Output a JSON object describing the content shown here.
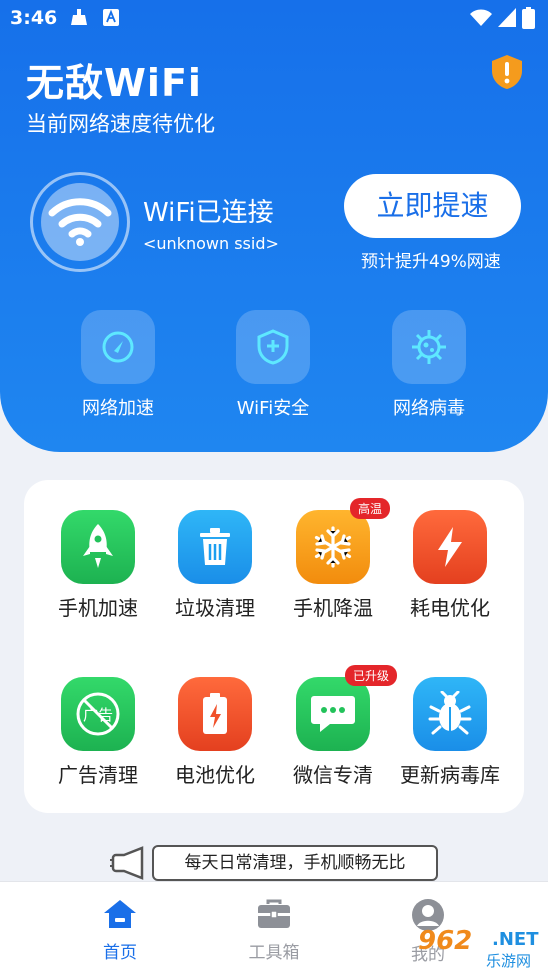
{
  "status_bar": {
    "time": "3:46"
  },
  "header": {
    "title": "无敌WiFi",
    "subtitle": "当前网络速度待优化"
  },
  "connection": {
    "status": "WiFi已连接",
    "ssid": "<unknown ssid>"
  },
  "boost": {
    "button_label": "立即提速",
    "hint": "预计提升49%网速"
  },
  "quick_actions": [
    {
      "label": "网络加速",
      "icon": "speedometer-icon"
    },
    {
      "label": "WiFi安全",
      "icon": "shield-plus-icon"
    },
    {
      "label": "网络病毒",
      "icon": "virus-icon"
    }
  ],
  "tools": [
    {
      "label": "手机加速",
      "icon": "rocket-icon",
      "badge": "",
      "color": "#22c25a"
    },
    {
      "label": "垃圾清理",
      "icon": "trash-icon",
      "badge": "",
      "color": "#1c9ff0"
    },
    {
      "label": "手机降温",
      "icon": "snowflake-icon",
      "badge": "高温",
      "color": "#f5a012"
    },
    {
      "label": "耗电优化",
      "icon": "lightning-icon",
      "badge": "",
      "color": "#f0502a"
    },
    {
      "label": "广告清理",
      "icon": "no-ad-icon",
      "badge": "",
      "color": "#22c25a"
    },
    {
      "label": "电池优化",
      "icon": "battery-icon",
      "badge": "",
      "color": "#f0502a"
    },
    {
      "label": "微信专清",
      "icon": "chat-bubble-icon",
      "badge": "已升级",
      "color": "#22c25a"
    },
    {
      "label": "更新病毒库",
      "icon": "bug-icon",
      "badge": "",
      "color": "#1c9ff0"
    }
  ],
  "icon_texts": {
    "ad": "广告"
  },
  "tip": {
    "text": "每天日常清理，手机顺畅无比"
  },
  "tabs": [
    {
      "label": "首页",
      "icon": "home-icon",
      "active": true
    },
    {
      "label": "工具箱",
      "icon": "toolbox-icon",
      "active": false
    },
    {
      "label": "我的",
      "icon": "user-icon",
      "active": false
    }
  ],
  "watermark": {
    "number": "962",
    "suffix": ".NET",
    "text": "乐游网"
  },
  "colors": {
    "primary": "#1a6fe8",
    "active_tab": "#1a6fe8",
    "inactive_tab": "#9a9ca3",
    "badge": "#e4262a",
    "warning": "#f59b1d"
  }
}
